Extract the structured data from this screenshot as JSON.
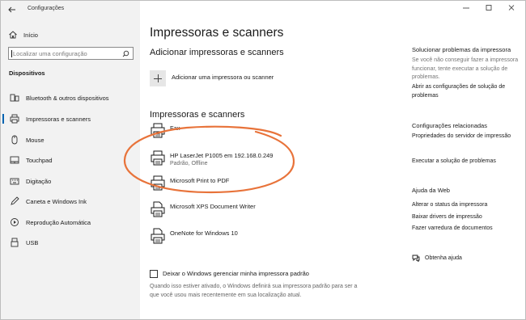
{
  "window": {
    "title": "Configurações",
    "controls": [
      "minimize-icon",
      "maximize-icon",
      "close-icon"
    ]
  },
  "sidebar": {
    "home_label": "Início",
    "search_placeholder": "Localizar uma configuração",
    "section_title": "Dispositivos",
    "items": [
      {
        "label": "Bluetooth & outros dispositivos",
        "icon": "bluetooth-icon"
      },
      {
        "label": "Impressoras e scanners",
        "icon": "printer-icon",
        "active": true
      },
      {
        "label": "Mouse",
        "icon": "mouse-icon"
      },
      {
        "label": "Touchpad",
        "icon": "touchpad-icon"
      },
      {
        "label": "Digitação",
        "icon": "keyboard-icon"
      },
      {
        "label": "Caneta e Windows Ink",
        "icon": "pen-icon"
      },
      {
        "label": "Reprodução Automática",
        "icon": "autoplay-icon"
      },
      {
        "label": "USB",
        "icon": "usb-icon"
      }
    ]
  },
  "main": {
    "title": "Impressoras e scanners",
    "add_section_title": "Adicionar impressoras e scanners",
    "add_button_label": "Adicionar uma impressora ou scanner",
    "printers_section_title": "Impressoras e scanners",
    "printers": [
      {
        "name": "Fax",
        "status": ""
      },
      {
        "name": "HP LaserJet P1005 em 192.168.0.249",
        "status": "Padrão, Offline"
      },
      {
        "name": "Microsoft Print to PDF",
        "status": ""
      },
      {
        "name": "Microsoft XPS Document Writer",
        "status": ""
      },
      {
        "name": "OneNote for Windows 10",
        "status": ""
      }
    ],
    "default_printer_checkbox_label": "Deixar o Windows gerenciar minha impressora padrão",
    "default_printer_checked": false,
    "default_printer_hint": "Quando isso estiver ativado, o Windows definirá sua impressora padrão para ser a que você usou mais recentemente em sua localização atual."
  },
  "right": {
    "troubleshoot_title": "Solucionar problemas da impressora",
    "troubleshoot_text": "Se você não conseguir fazer a impressora funcionar, tente executar a solução de problemas.",
    "troubleshoot_link": "Abrir as configurações de solução de problemas",
    "related_title": "Configurações relacionadas",
    "related_links": [
      "Propriedades do servidor de impressão",
      "Executar a solução de problemas"
    ],
    "help_title": "Ajuda da Web",
    "help_links": [
      "Alterar o status da impressora",
      "Baixar drivers de impressão",
      "Fazer varredura de documentos"
    ],
    "get_help_label": "Obtenha ajuda"
  },
  "colors": {
    "accent": "#0063b1",
    "annotation": "#e8733a",
    "sidebar_bg": "#f2f2f2"
  }
}
